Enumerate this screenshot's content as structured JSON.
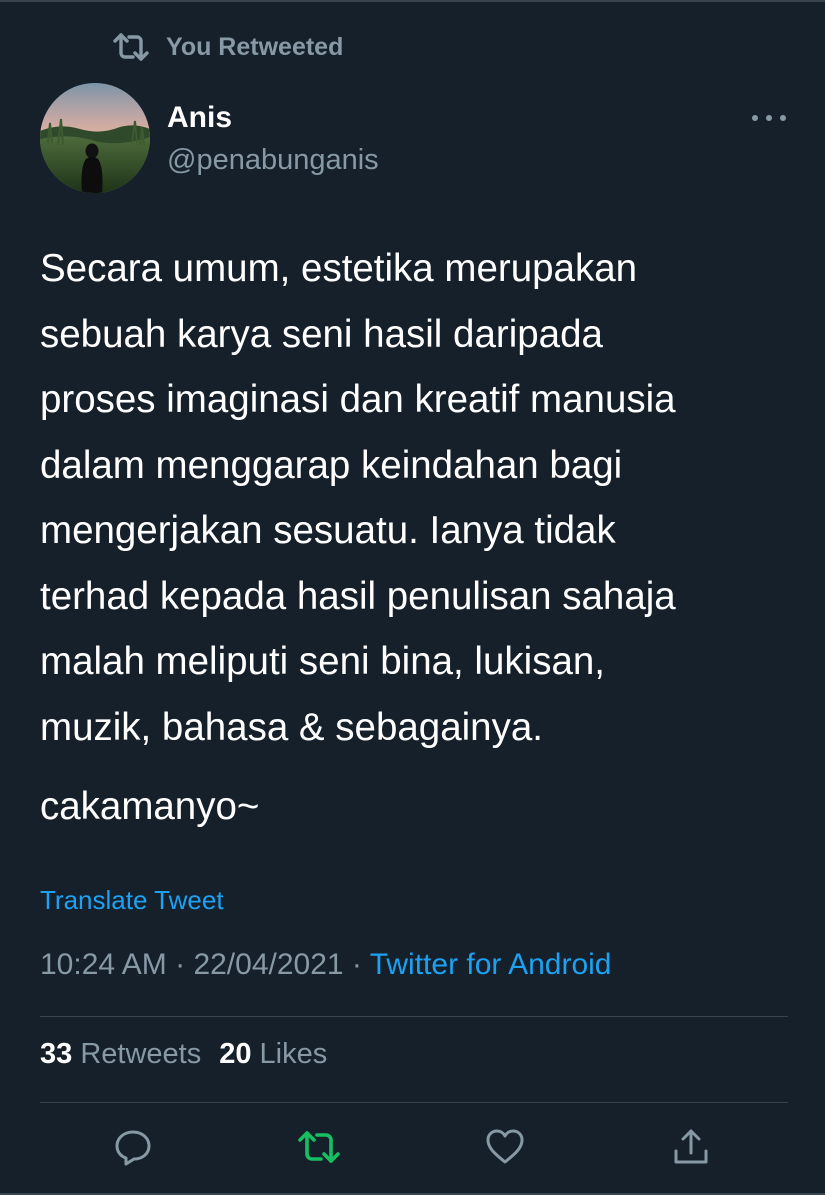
{
  "retweet_banner": {
    "icon": "retweet-icon",
    "label": "You Retweeted"
  },
  "author": {
    "name": "Anis",
    "handle": "@penabunganis",
    "avatar_icon": "avatar-photo"
  },
  "tweet": {
    "lines": [
      "Secara umum, estetika merupakan",
      "sebuah karya seni hasil daripada",
      "proses imaginasi dan kreatif manusia",
      "dalam menggarap keindahan bagi",
      "mengerjakan sesuatu. Ianya tidak",
      "terhad kepada hasil penulisan sahaja",
      "malah meliputi seni bina, lukisan,",
      "muzik, bahasa & sebagainya."
    ],
    "tail": "cakamanyo~"
  },
  "translate_label": "Translate Tweet",
  "meta": {
    "time": "10:24 AM",
    "sep1": " · ",
    "date": "22/04/2021",
    "sep2": " · ",
    "source": "Twitter for Android"
  },
  "stats": {
    "retweets_count": "33",
    "retweets_label": "Retweets",
    "likes_count": "20",
    "likes_label": "Likes"
  },
  "actions": {
    "reply": "reply-icon",
    "retweet": "retweet-icon",
    "like": "like-icon",
    "share": "share-icon"
  },
  "colors": {
    "background": "#15202b",
    "text": "#ffffff",
    "muted": "#8899a6",
    "link": "#1da1f2",
    "retweet_active": "#17bf63",
    "divider": "#38444d"
  }
}
